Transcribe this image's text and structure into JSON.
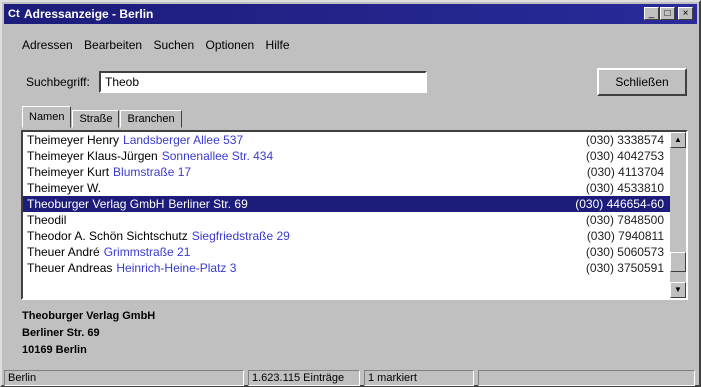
{
  "window": {
    "title": "Adressanzeige - Berlin",
    "app_icon": "Ct",
    "controls": [
      "minimize-icon",
      "maximize-icon",
      "close-icon"
    ]
  },
  "menu": [
    "Adressen",
    "Bearbeiten",
    "Suchen",
    "Optionen",
    "Hilfe"
  ],
  "search": {
    "label": "Suchbegriff:",
    "value": "Theob"
  },
  "close_button": "Schließen",
  "tabs": [
    "Namen",
    "Straße",
    "Branchen"
  ],
  "list": {
    "rows": [
      {
        "name": "Theimeyer Henry",
        "addr": "Landsberger Allee 537",
        "phone": "(030) 3338574"
      },
      {
        "name": "Theimeyer Klaus-Jürgen",
        "addr": "Sonnenallee Str. 434",
        "phone": "(030) 4042753"
      },
      {
        "name": "Theimeyer Kurt",
        "addr": "Blumstraße 17",
        "phone": "(030) 4113704"
      },
      {
        "name": "Theimeyer W.",
        "addr": "",
        "phone": "(030) 4533810"
      },
      {
        "name": "Theoburger Verlag GmbH",
        "addr": "Berliner Str. 69",
        "phone": "(030) 446654-60"
      },
      {
        "name": "Theodil",
        "addr": "",
        "phone": "(030) 7848500"
      },
      {
        "name": "Theodor A. Schön Sichtschutz",
        "addr": "Siegfriedstraße 29",
        "phone": "(030) 7940811"
      },
      {
        "name": "Theuer André",
        "addr": "Grimmstraße 21",
        "phone": "(030) 5060573"
      },
      {
        "name": "Theuer Andreas",
        "addr": "Heinrich-Heine-Platz 3",
        "phone": "(030) 3750591"
      }
    ],
    "selected_index": 4
  },
  "detail": {
    "line1": "Theoburger Verlag GmbH",
    "line2": "Berliner Str. 69",
    "line3": "10169 Berlin"
  },
  "status": {
    "city": "Berlin",
    "count": "1.623.115 Einträge",
    "state": "1 markiert"
  }
}
